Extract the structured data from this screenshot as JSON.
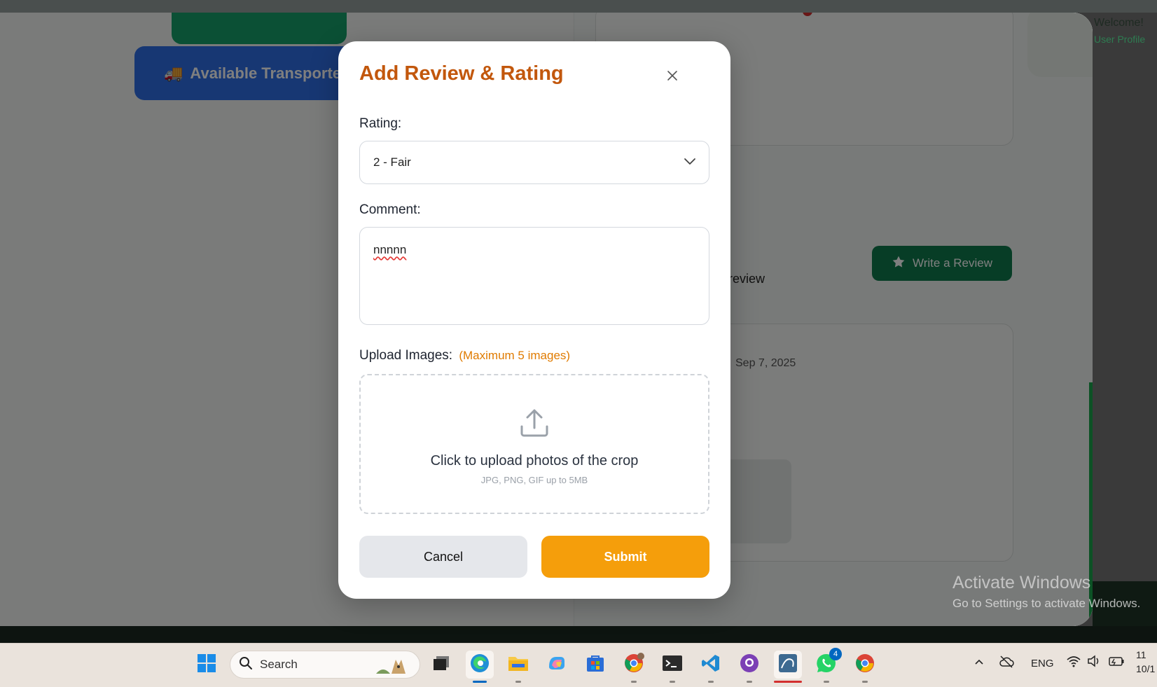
{
  "background_page": {
    "transport_button_label": "Available Transporters",
    "welcome_title": "Welcome!",
    "welcome_subtitle": "User Profile",
    "write_review_label": "Write a Review",
    "review_partial_text": "review",
    "review_date": "Sep 7, 2025"
  },
  "modal": {
    "title": "Add Review & Rating",
    "rating_label": "Rating:",
    "rating_selected": "2 - Fair",
    "comment_label": "Comment:",
    "comment_value": "nnnnn",
    "upload_label": "Upload Images:",
    "upload_limit": "(Maximum 5 images)",
    "dropzone_title": "Click to upload photos of the crop",
    "dropzone_hint": "JPG, PNG, GIF up to 5MB",
    "cancel_label": "Cancel",
    "submit_label": "Submit"
  },
  "watermark": {
    "title": "Activate Windows",
    "subtitle": "Go to Settings to activate Windows."
  },
  "taskbar": {
    "search_placeholder": "Search",
    "whatsapp_badge": "4",
    "language": "ENG",
    "clock_time": "11",
    "clock_date": "10/1"
  },
  "colors": {
    "modal_title": "#c2570c",
    "upload_limit": "#e07b00",
    "submit_bg": "#f59e0b",
    "cancel_bg": "#e5e7eb",
    "write_review_bg": "#0f7b4d",
    "transport_bg": "#2f6fe6"
  }
}
